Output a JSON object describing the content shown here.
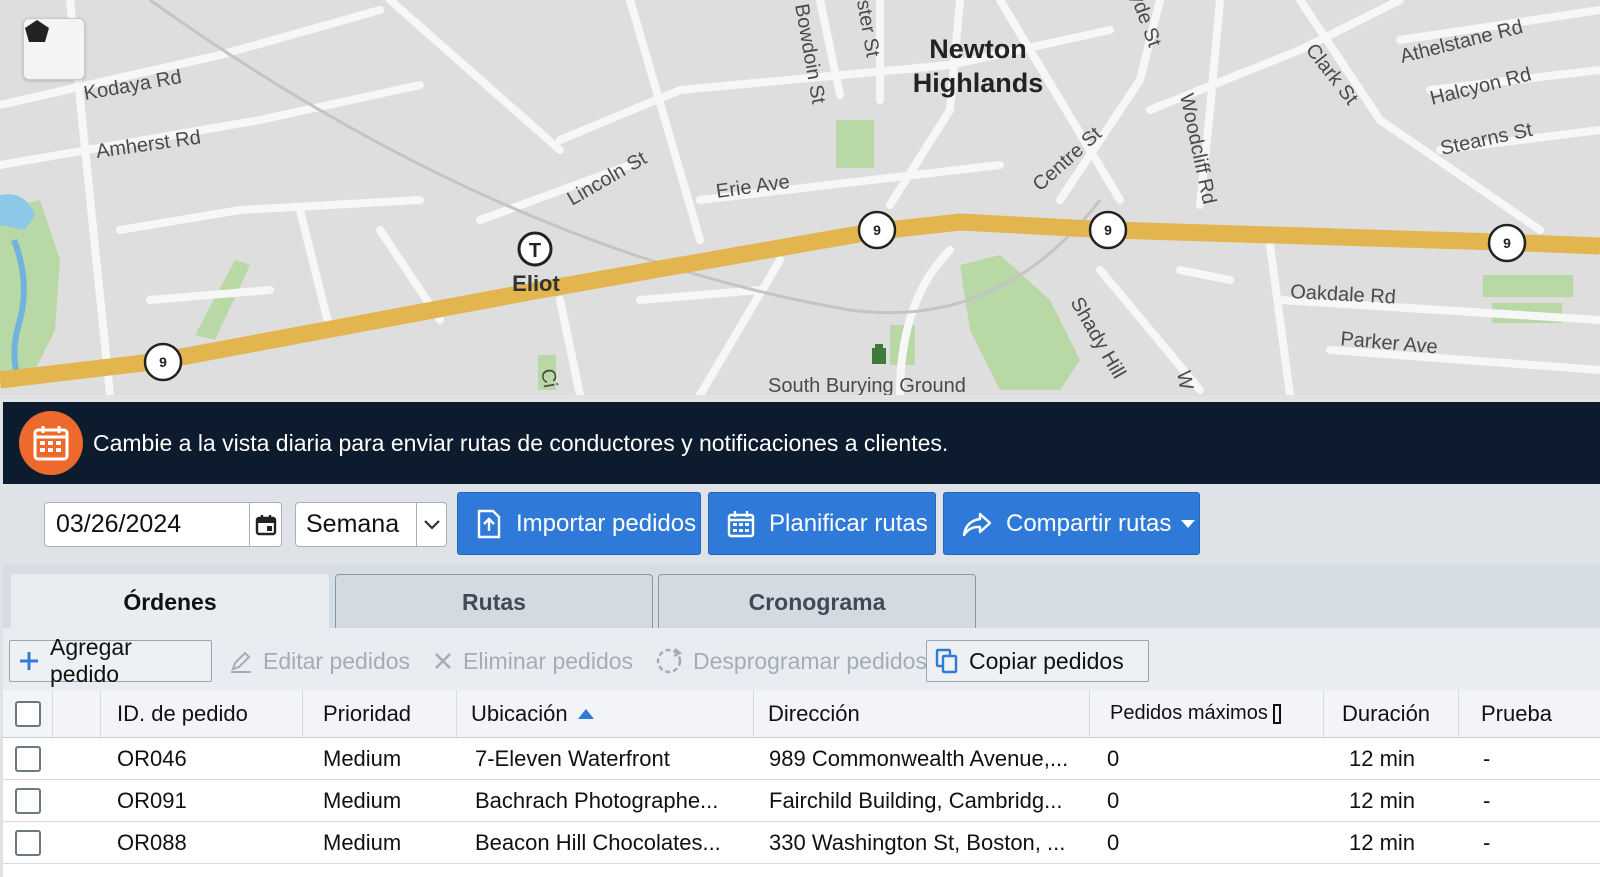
{
  "map": {
    "places": [
      "Newton",
      "Highlands",
      "Eliot",
      "South Burying Ground"
    ],
    "streets": [
      "Kodaya Rd",
      "Amherst Rd",
      "Lincoln St",
      "Erie Ave",
      "Bowdoin St",
      "ester St",
      "yde St",
      "Woodcliff Rd",
      "Clark St",
      "Athelstane Rd",
      "Halcyon Rd",
      "Stearns St",
      "Centre St",
      "Oakdale Rd",
      "Parker Ave",
      "Shady Hill",
      "Ci",
      "W"
    ],
    "route_shield": "9",
    "transit_icon": "T",
    "tool_icon": "polygon-draw-icon"
  },
  "banner": {
    "icon": "calendar-icon",
    "text": "Cambie a la vista diaria para enviar rutas de conductores y notificaciones a clientes."
  },
  "toolbar": {
    "date_value": "03/26/2024",
    "period_value": "Semana",
    "import_label": "Importar pedidos",
    "plan_label": "Planificar rutas",
    "share_label": "Compartir rutas"
  },
  "tabs": [
    {
      "label": "Órdenes",
      "active": true
    },
    {
      "label": "Rutas",
      "active": false
    },
    {
      "label": "Cronograma",
      "active": false
    }
  ],
  "actions": {
    "add": "Agregar pedido",
    "edit": "Editar pedidos",
    "delete": "Eliminar pedidos",
    "unschedule": "Desprogramar pedidos",
    "copy": "Copiar pedidos"
  },
  "table": {
    "columns": [
      "ID. de pedido",
      "Prioridad",
      "Ubicación",
      "Dirección",
      "Pedidos máximos",
      "Duración",
      "Prueba"
    ],
    "rows": [
      {
        "id": "OR046",
        "priority": "Medium",
        "location": "7-Eleven Waterfront",
        "address": "989 Commonwealth Avenue,...",
        "max": "0",
        "duration": "12 min",
        "test": "-"
      },
      {
        "id": "OR091",
        "priority": "Medium",
        "location": "Bachrach Photographe...",
        "address": "Fairchild Building, Cambridg...",
        "max": "0",
        "duration": "12 min",
        "test": "-"
      },
      {
        "id": "OR088",
        "priority": "Medium",
        "location": "Beacon Hill Chocolates...",
        "address": "330 Washington St, Boston, ...",
        "max": "0",
        "duration": "12 min",
        "test": "-"
      }
    ]
  },
  "colors": {
    "highway": "#e3b54f",
    "banner_bg": "#0d1b2e",
    "banner_icon": "#ec6a2c",
    "primary_button": "#2f7ad8",
    "park": "#b8d9a6"
  }
}
